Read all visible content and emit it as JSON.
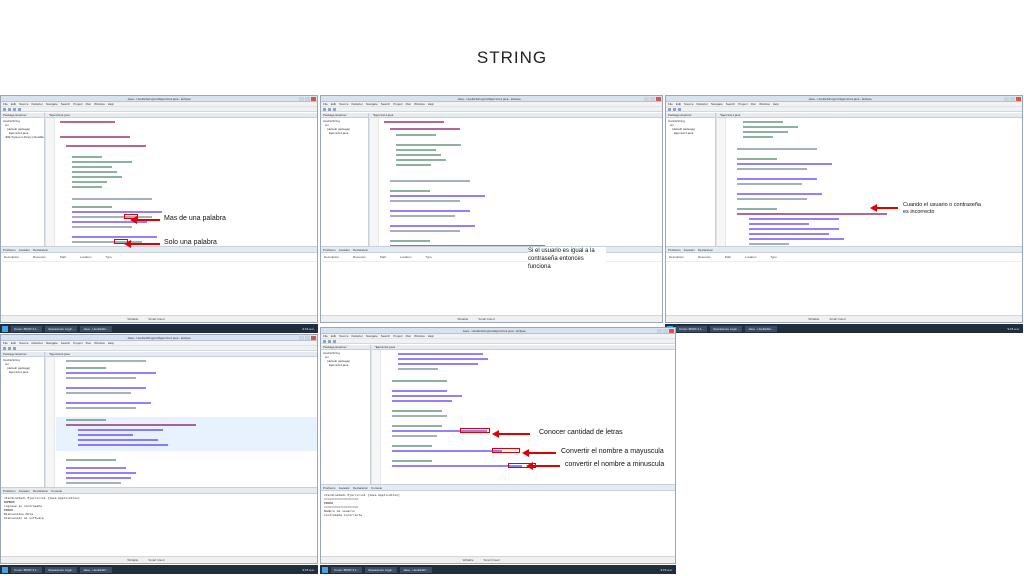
{
  "slide": {
    "title": "STRING"
  },
  "windows": {
    "title_1": "Java - UsoDeString/src/Ejercicio1.java - Eclipse",
    "title_2": "Java - UsoDeString/src/Ejercicio1.java - Eclipse",
    "title_3": "Java - UsoDeString/src/Ejercicio1.java - Eclipse",
    "title_4": "Java - UsoDeString/src/Ejercicio1.java - Eclipse",
    "title_5": "Java - UsoDeString/src/Ejercicio1.java - Eclipse",
    "menu": [
      "File",
      "Edit",
      "Source",
      "Refactor",
      "Navigate",
      "Search",
      "Project",
      "Run",
      "Window",
      "Help"
    ],
    "explorer_tab": "Package Explorer",
    "editor_tab": "*Ejercicio1.java",
    "tree": [
      "UsoDeString",
      "src",
      "(default package)",
      "Ejercicio1.java",
      "JRE System Library [JavaSE-1.8]"
    ],
    "bottom_tabs": [
      "Problems",
      "Javadoc",
      "Declaration"
    ],
    "bottom_tabs_console": [
      "Problems",
      "Javadoc",
      "Declaration",
      "Console"
    ],
    "problem_cols": [
      "Description",
      "Resource",
      "Path",
      "Location",
      "Type"
    ],
    "status": [
      "Writable",
      "Smart Insert"
    ]
  },
  "console": {
    "window4_lines": [
      "<terminated> Ejercicio1 [Java Application]",
      "NOMBRE",
      "ingrese su contraseña",
      "ERROR",
      "Bienvenidos Hola",
      "bienvenido al software"
    ],
    "window5_lines": [
      "<terminated> Ejercicio1 [Java Application]",
      "===================",
      "ERROR",
      "===================",
      "Nombre de usuario",
      "Contraseña incorrecta"
    ]
  },
  "taskbar": {
    "items": [
      "Curso: BDWI 3.1...",
      "Operadores Lógic...",
      "Java - UsoDeStri..."
    ],
    "clock": "9:15 a.m."
  },
  "annotations": {
    "mas_de_una_palabra": "Mas de una palabra",
    "solo_una_palabra": "Solo una palabra",
    "si_el_usuario": "Si el usuario es igual a la contraseña entonces funciona",
    "cuando_el_usuario": "Cuando el usuario o contraseña es incorrecto",
    "conocer_cantidad": "Conocer cantidad de letras",
    "convertir_mayuscula": "Convertir el nombre a mayuscula",
    "convertir_minuscula": "convertir el nombre a minuscula"
  }
}
